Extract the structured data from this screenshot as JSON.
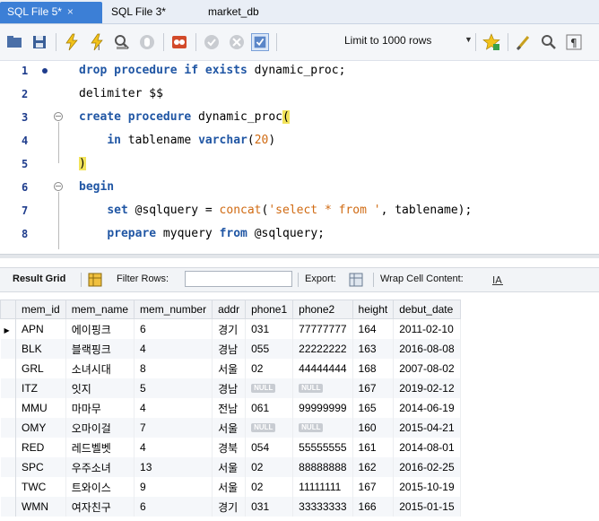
{
  "tabs": [
    {
      "label": "SQL File 5*",
      "close": "×"
    },
    {
      "label": "SQL File 3*"
    },
    {
      "label": "market_db"
    }
  ],
  "toolbar": {
    "limit_label": "Limit to 1000 rows"
  },
  "editor": {
    "lines": [
      {
        "num": "1",
        "text": "drop procedure if exists dynamic_proc;"
      },
      {
        "num": "2",
        "text": "delimiter $$"
      },
      {
        "num": "3",
        "text": "create procedure dynamic_proc("
      },
      {
        "num": "4",
        "text": "    in tablename varchar(20)"
      },
      {
        "num": "5",
        "text": ")"
      },
      {
        "num": "6",
        "text": "begin"
      },
      {
        "num": "7",
        "text": "    set @sqlquery = concat('select * from ', tablename);"
      },
      {
        "num": "8",
        "text": "    prepare myquery from @sqlquery;"
      }
    ]
  },
  "result_bar": {
    "result_grid": "Result Grid",
    "filter_rows": "Filter Rows:",
    "export": "Export:",
    "wrap": "Wrap Cell Content:"
  },
  "grid": {
    "columns": [
      "mem_id",
      "mem_name",
      "mem_number",
      "addr",
      "phone1",
      "phone2",
      "height",
      "debut_date"
    ],
    "null_label": "NULL",
    "rows": [
      [
        "APN",
        "에이핑크",
        "6",
        "경기",
        "031",
        "77777777",
        "164",
        "2011-02-10"
      ],
      [
        "BLK",
        "블랙핑크",
        "4",
        "경남",
        "055",
        "22222222",
        "163",
        "2016-08-08"
      ],
      [
        "GRL",
        "소녀시대",
        "8",
        "서울",
        "02",
        "44444444",
        "168",
        "2007-08-02"
      ],
      [
        "ITZ",
        "잇지",
        "5",
        "경남",
        null,
        null,
        "167",
        "2019-02-12"
      ],
      [
        "MMU",
        "마마무",
        "4",
        "전남",
        "061",
        "99999999",
        "165",
        "2014-06-19"
      ],
      [
        "OMY",
        "오마이걸",
        "7",
        "서울",
        null,
        null,
        "160",
        "2015-04-21"
      ],
      [
        "RED",
        "레드벨벳",
        "4",
        "경북",
        "054",
        "55555555",
        "161",
        "2014-08-01"
      ],
      [
        "SPC",
        "우주소녀",
        "13",
        "서울",
        "02",
        "88888888",
        "162",
        "2016-02-25"
      ],
      [
        "TWC",
        "트와이스",
        "9",
        "서울",
        "02",
        "11111111",
        "167",
        "2015-10-19"
      ],
      [
        "WMN",
        "여자친구",
        "6",
        "경기",
        "031",
        "33333333",
        "166",
        "2015-01-15"
      ]
    ]
  }
}
